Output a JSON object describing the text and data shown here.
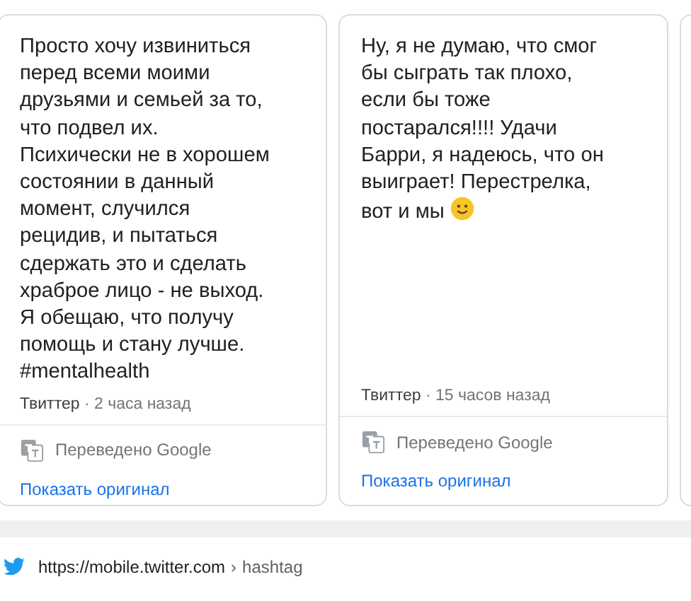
{
  "cards": [
    {
      "text": "Просто хочу извиниться\nперед всеми моими\nдрузьями и семьей за то,\nчто подвел их.\nПсихически не в хорошем\nсостоянии в данный\nмомент, случился\nрецидив, и пытаться\nсдержать это и сделать\nхраброе лицо - не выход.\nЯ обещаю, что получу\nпомощь и стану лучше.\n#mentalhealth",
      "emoji": false,
      "source": "Твиттер",
      "separator": "·",
      "time": "2 часа назад",
      "translated": "Переведено Google",
      "show_original": "Показать оригинал"
    },
    {
      "text": "Ну, я не думаю, что смог\nбы сыграть так плохо,\nесли бы тоже\nпостарался!!!! Удачи\nБарри, я надеюсь, что он\nвыиграет! Перестрелка,\nвот и мы",
      "emoji": true,
      "source": "Твиттер",
      "separator": "·",
      "time": "15 часов назад",
      "translated": "Переведено Google",
      "show_original": "Показать оригинал"
    }
  ],
  "result": {
    "url": "https://mobile.twitter.com",
    "separator": "›",
    "path": "hashtag"
  }
}
